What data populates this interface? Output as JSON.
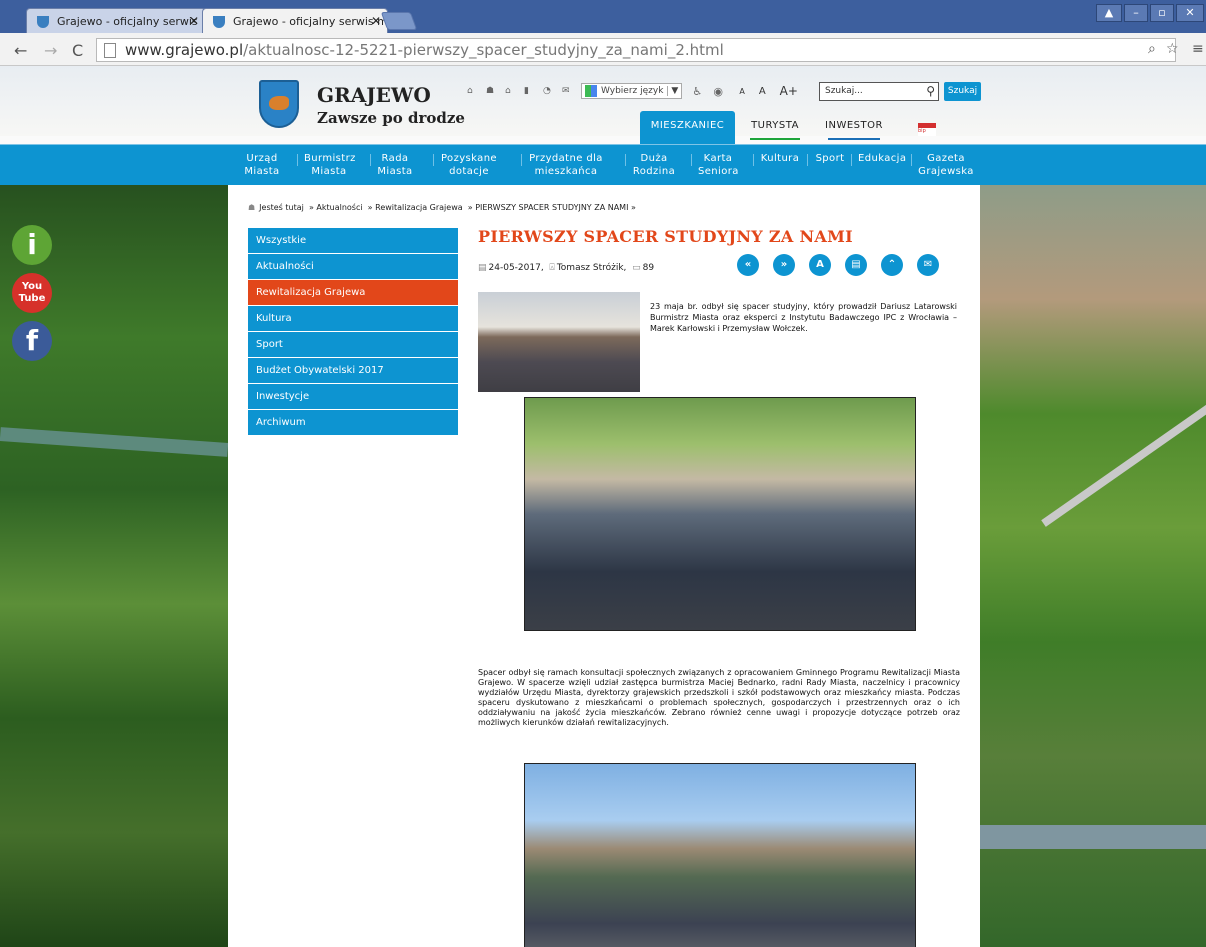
{
  "browser": {
    "tabs": [
      {
        "label": "Grajewo - oficjalny serwis mi"
      },
      {
        "label": "Grajewo - oficjalny serwis mi"
      }
    ],
    "url_domain": "www.grajewo.pl",
    "url_path": "/aktualnosc-12-5221-pierwszy_spacer_studyjny_za_nami_2.html"
  },
  "header": {
    "logo_title": "GRAJEWO",
    "logo_subtitle": "Zawsze po drodze",
    "language_label": "Wybierz język",
    "font_small": "A",
    "font_medium": "A",
    "font_large": "A+",
    "search_placeholder": "Szukaj...",
    "search_button": "Szukaj",
    "tabs": [
      "MIESZKANIEC",
      "TURYSTA",
      "INWESTOR"
    ],
    "bip_label": "bip"
  },
  "menu": [
    {
      "line1": "Urząd",
      "line2": "Miasta"
    },
    {
      "line1": "Burmistrz",
      "line2": "Miasta"
    },
    {
      "line1": "Rada",
      "line2": "Miasta"
    },
    {
      "line1": "Pozyskane",
      "line2": "dotacje"
    },
    {
      "line1": "Przydatne dla",
      "line2": "mieszkańca"
    },
    {
      "line1": "Duża",
      "line2": "Rodzina"
    },
    {
      "line1": "Karta",
      "line2": "Seniora"
    },
    {
      "line1": "Kultura",
      "line2": ""
    },
    {
      "line1": "Sport",
      "line2": ""
    },
    {
      "line1": "Edukacja",
      "line2": ""
    },
    {
      "line1": "Gazeta",
      "line2": "Grajewska"
    }
  ],
  "breadcrumb": {
    "home": "Jesteś tutaj",
    "items": [
      "Aktualności",
      "Rewitalizacja Grajewa",
      "PIERWSZY SPACER STUDYJNY ZA NAMI"
    ]
  },
  "sidebar": {
    "items": [
      "Wszystkie",
      "Aktualności",
      "Rewitalizacja Grajewa",
      "Kultura",
      "Sport",
      "Budżet Obywatelski 2017",
      "Inwestycje",
      "Archiwum"
    ],
    "active_index": 2
  },
  "article": {
    "title": "PIERWSZY SPACER STUDYJNY ZA NAMI",
    "date": "24-05-2017,",
    "author": "Tomasz Stróżik,",
    "views": "89",
    "intro": "23 maja br. odbył się spacer studyjny, który prowadził Dariusz Latarowski Burmistrz Miasta oraz eksperci z Instytutu Badawczego IPC z Wrocławia – Marek Karłowski i Przemysław Wołczek.",
    "body": "Spacer odbył się ramach konsultacji społecznych związanych z opracowaniem Gminnego Programu Rewitalizacji Miasta Grajewo. W spacerze wzięli udział zastępca burmistrza Maciej Bednarko, radni Rady Miasta, naczelnicy i pracownicy wydziałów Urzędu Miasta, dyrektorzy grajewskich przedszkoli i szkół podstawowych oraz mieszkańcy miasta. Podczas spaceru dyskutowano z mieszkańcami o problemach społecznych, gospodarczych i przestrzennych oraz o ich oddziaływaniu na jakość życia mieszkańców. Zebrano również cenne uwagi i propozycje dotyczące potrzeb oraz możliwych kierunków działań rewitalizacyjnych."
  },
  "colors": {
    "brand_blue": "#0d94d1",
    "accent_orange": "#e2471a"
  }
}
